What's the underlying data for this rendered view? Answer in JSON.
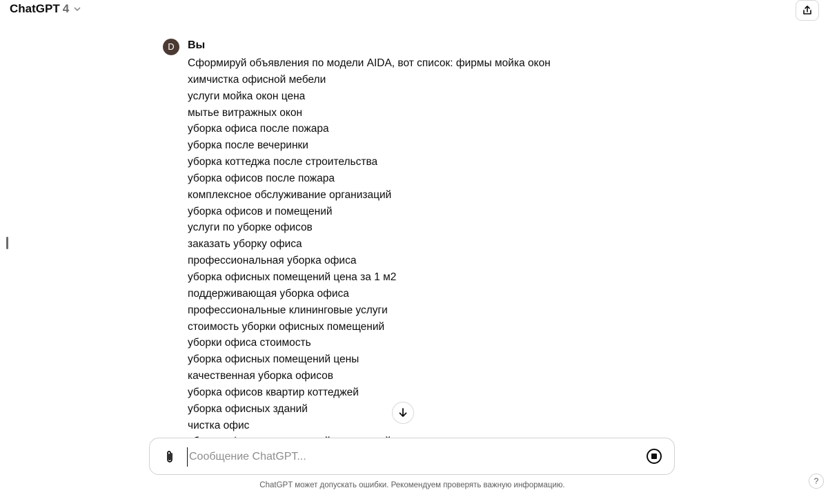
{
  "header": {
    "model_name": "ChatGPT",
    "model_version": "4"
  },
  "message": {
    "avatar_letter": "D",
    "author": "Вы",
    "lines": [
      "Сформируй объявления по модели AIDA, вот список: фирмы мойка окон",
      "химчистка офисной мебели",
      "услуги мойка окон цена",
      "мытье витражных окон",
      "уборка офиса после пожара",
      "уборка после вечеринки",
      "уборка коттеджа после строительства",
      "уборка офисов после пожара",
      "комплексное обслуживание организаций",
      "уборка офисов и помещений",
      "услуги по уборке офисов",
      "заказать уборку офиса",
      "профессиональная уборка офиса",
      "уборка офисных помещений цена за 1 м2",
      "поддерживающая уборка офиса",
      "профессиональные клининговые услуги",
      "стоимость уборки офисных помещений",
      "уборки офиса стоимость",
      "уборка офисных помещений цены",
      "качественная уборка офисов",
      "уборка офисов квартир коттеджей",
      "уборка офисных зданий",
      "чистка офис",
      "уборка офисных помещений стоимостей"
    ]
  },
  "composer": {
    "placeholder": "Сообщение ChatGPT..."
  },
  "footer": {
    "disclaimer": "ChatGPT может допускать ошибки. Рекомендуем проверять важную информацию.",
    "help_label": "?"
  }
}
